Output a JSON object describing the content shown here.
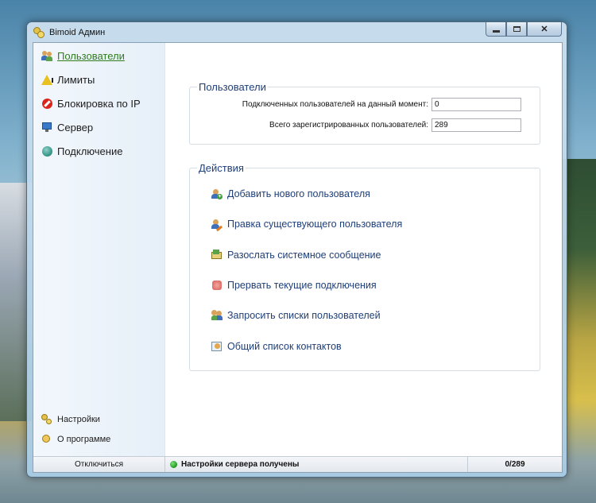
{
  "window": {
    "title": "Bimoid Админ"
  },
  "sidebar": {
    "items": [
      {
        "label": "Пользователи",
        "icon": "users-icon",
        "active": true
      },
      {
        "label": "Лимиты",
        "icon": "warning-icon"
      },
      {
        "label": "Блокировка по IP",
        "icon": "block-icon"
      },
      {
        "label": "Сервер",
        "icon": "monitor-icon"
      },
      {
        "label": "Подключение",
        "icon": "globe-icon"
      }
    ],
    "bottom": [
      {
        "label": "Настройки",
        "icon": "keys-icon"
      },
      {
        "label": "О программе",
        "icon": "info-face-icon"
      }
    ]
  },
  "users_group": {
    "title": "Пользователи",
    "online_label": "Подключенных пользователей на данный момент:",
    "online_value": "0",
    "total_label": "Всего зарегистрированных пользователей:",
    "total_value": "289"
  },
  "actions_group": {
    "title": "Действия",
    "items": [
      {
        "label": "Добавить нового пользователя",
        "icon": "add-user-icon"
      },
      {
        "label": "Правка существующего пользователя",
        "icon": "edit-user-icon"
      },
      {
        "label": "Разослать системное сообщение",
        "icon": "broadcast-message-icon"
      },
      {
        "label": "Прервать текущие подключения",
        "icon": "disconnect-icon"
      },
      {
        "label": "Запросить списки пользователей",
        "icon": "user-lists-icon"
      },
      {
        "label": "Общий список контактов",
        "icon": "contact-card-icon"
      }
    ]
  },
  "statusbar": {
    "disconnect_label": "Отключиться",
    "status_text": "Настройки сервера получены",
    "status_color": "#1e9a1e",
    "counter": "0/289"
  },
  "colors": {
    "link": "#1f3f78",
    "active_nav": "#2f7d1f"
  }
}
